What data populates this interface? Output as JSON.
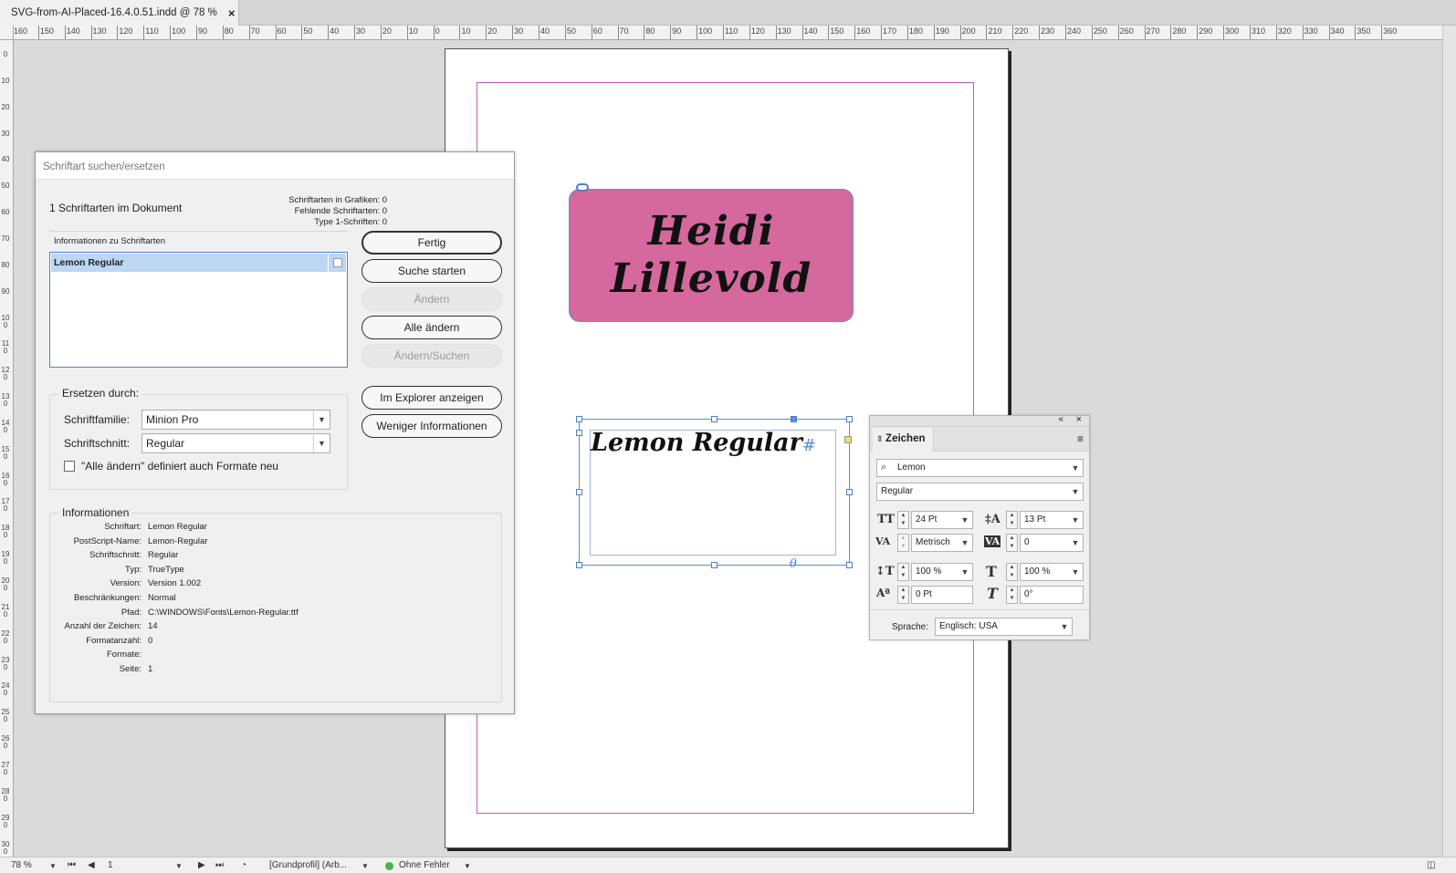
{
  "tab": {
    "title": "SVG-from-AI-Placed-16.4.0.51.indd @ 78 %",
    "close": "×"
  },
  "ruler": {
    "top_labels": [
      "160",
      "150",
      "140",
      "130",
      "120",
      "110",
      "100",
      "90",
      "80",
      "70",
      "60",
      "50",
      "40",
      "30",
      "20",
      "10",
      "0",
      "10",
      "20",
      "30",
      "40",
      "50",
      "60",
      "70",
      "80",
      "90",
      "100",
      "110",
      "120",
      "130",
      "140",
      "150",
      "160",
      "170",
      "180",
      "190",
      "200",
      "210",
      "220",
      "230",
      "240",
      "250",
      "260",
      "270",
      "280",
      "290",
      "300",
      "310",
      "320",
      "330",
      "340",
      "350",
      "360"
    ],
    "left_labels": [
      "0",
      "10",
      "20",
      "30",
      "40",
      "50",
      "60",
      "70",
      "80",
      "90",
      "100",
      "110",
      "120",
      "130",
      "140",
      "150",
      "160",
      "170",
      "180",
      "190",
      "200",
      "210",
      "220",
      "230",
      "240",
      "250",
      "260",
      "270",
      "280",
      "290",
      "300"
    ]
  },
  "document": {
    "name_line1": "Heidi",
    "name_line2": "Lillevold",
    "frame_text": "Lemon Regular",
    "frame_hash": "#"
  },
  "dialog": {
    "title": "Schriftart suchen/ersetzen",
    "count": "1 Schriftarten im Dokument",
    "stats": [
      "Schriftarten in Grafiken: 0",
      "Fehlende Schriftarten: 0",
      "Type 1-Schriften: 0"
    ],
    "fonts_info_label": "Informationen zu Schriftarten",
    "font_entry": "Lemon Regular",
    "buttons": {
      "done": "Fertig",
      "find": "Suche starten",
      "change": "Ändern",
      "change_all": "Alle ändern",
      "change_find": "Ändern/Suchen",
      "explorer": "Im Explorer anzeigen",
      "less_info": "Weniger Informationen"
    },
    "replace": {
      "title": "Ersetzen durch:",
      "family_label": "Schriftfamilie:",
      "family_value": "Minion Pro",
      "style_label": "Schriftschnitt:",
      "style_value": "Regular",
      "checkbox_label": "\"Alle ändern\" definiert auch Formate neu"
    },
    "info": {
      "title": "Informationen",
      "rows": [
        {
          "k": "Schriftart:",
          "v": "Lemon Regular"
        },
        {
          "k": "PostScript-Name:",
          "v": "Lemon-Regular"
        },
        {
          "k": "Schriftschnitt:",
          "v": "Regular"
        },
        {
          "k": "Typ:",
          "v": "TrueType"
        },
        {
          "k": "Version:",
          "v": "Version 1.002"
        },
        {
          "k": "Beschränkungen:",
          "v": "Normal"
        },
        {
          "k": "Pfad:",
          "v": "C:\\WINDOWS\\Fonts\\Lemon-Regular.ttf"
        },
        {
          "k": "Anzahl der Zeichen:",
          "v": "14"
        },
        {
          "k": "Formatanzahl:",
          "v": "0"
        },
        {
          "k": "Formate:",
          "v": ""
        },
        {
          "k": "Seite:",
          "v": "1"
        }
      ]
    }
  },
  "char_panel": {
    "tab": "Zeichen",
    "font_family": "Lemon",
    "font_style": "Regular",
    "size": "24 Pt",
    "leading": "13 Pt",
    "kerning": "Metrisch",
    "tracking": "0",
    "vscale": "100 %",
    "hscale": "100 %",
    "baseline": "0 Pt",
    "skew": "0°",
    "lang_label": "Sprache:",
    "lang_value": "Englisch: USA"
  },
  "status": {
    "zoom": "78 %",
    "page": "1",
    "profile": "[Grundprofil] (Arb...",
    "errors": "Ohne Fehler"
  },
  "colors": {
    "pink_frame": "#d5689d",
    "selection": "#5b8fd6",
    "margin": "#c15bc1",
    "status_ok": "#4cb04c"
  }
}
